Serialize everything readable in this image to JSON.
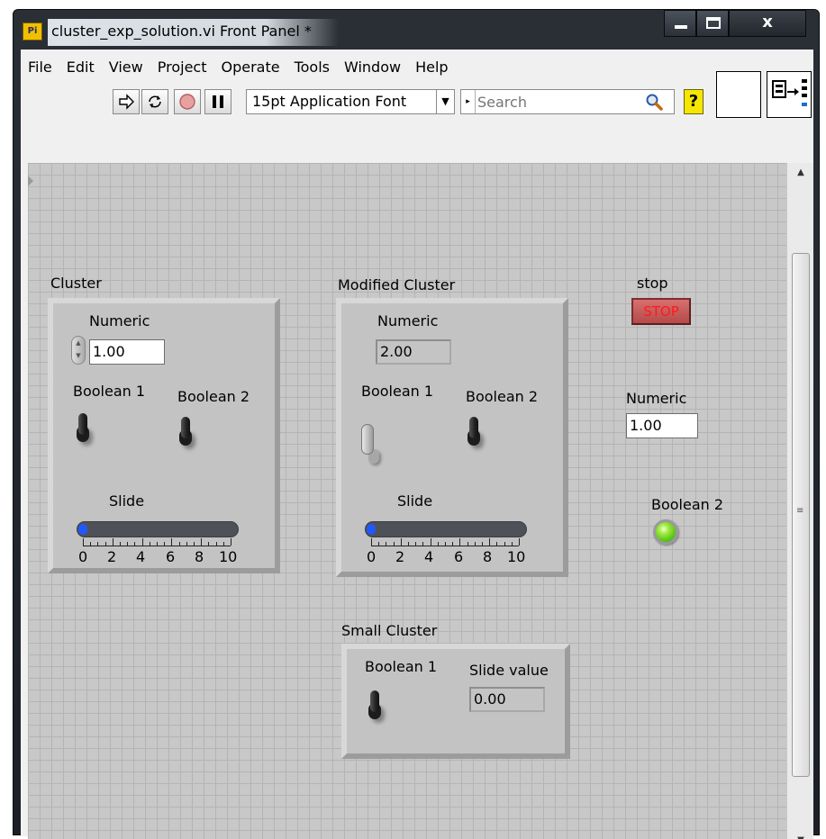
{
  "window": {
    "title": "cluster_exp_solution.vi Front Panel *",
    "icon_text": "Pi",
    "controls": {
      "minimize": "minimize-icon",
      "maximize": "maximize-icon",
      "close": "x"
    }
  },
  "menu": [
    "File",
    "Edit",
    "View",
    "Project",
    "Operate",
    "Tools",
    "Window",
    "Help"
  ],
  "toolbar": {
    "run": "run-arrow-icon",
    "run_continuously": "run-continuously-icon",
    "abort": "abort-icon",
    "pause": "pause-icon",
    "font": "15pt Application Font",
    "search_placeholder": "Search",
    "help": "?"
  },
  "panel": {
    "cluster": {
      "label": "Cluster",
      "numeric_label": "Numeric",
      "numeric_value": "1.00",
      "boolean1_label": "Boolean 1",
      "boolean1_value": false,
      "boolean2_label": "Boolean 2",
      "boolean2_value": false,
      "slide_label": "Slide",
      "slide_value": 0,
      "slide_scale": [
        "0",
        "2",
        "4",
        "6",
        "8",
        "10"
      ]
    },
    "modified_cluster": {
      "label": "Modified Cluster",
      "numeric_label": "Numeric",
      "numeric_value": "2.00",
      "boolean1_label": "Boolean 1",
      "boolean1_value": true,
      "boolean2_label": "Boolean 2",
      "boolean2_value": false,
      "slide_label": "Slide",
      "slide_value": 0,
      "slide_scale": [
        "0",
        "2",
        "4",
        "6",
        "8",
        "10"
      ]
    },
    "stop": {
      "label": "stop",
      "button_text": "STOP"
    },
    "numeric": {
      "label": "Numeric",
      "value": "1.00"
    },
    "boolean2_led": {
      "label": "Boolean 2",
      "value": true,
      "color": "#6ad61e"
    },
    "small_cluster": {
      "label": "Small Cluster",
      "boolean1_label": "Boolean 1",
      "boolean1_value": false,
      "slide_value_label": "Slide value",
      "slide_value": "0.00"
    }
  },
  "colors": {
    "panel_bg": "#c8c8c8",
    "grid": "#b4b4b4",
    "slide_fill": "#1f58ff",
    "stop_text": "#ff1a1a"
  }
}
